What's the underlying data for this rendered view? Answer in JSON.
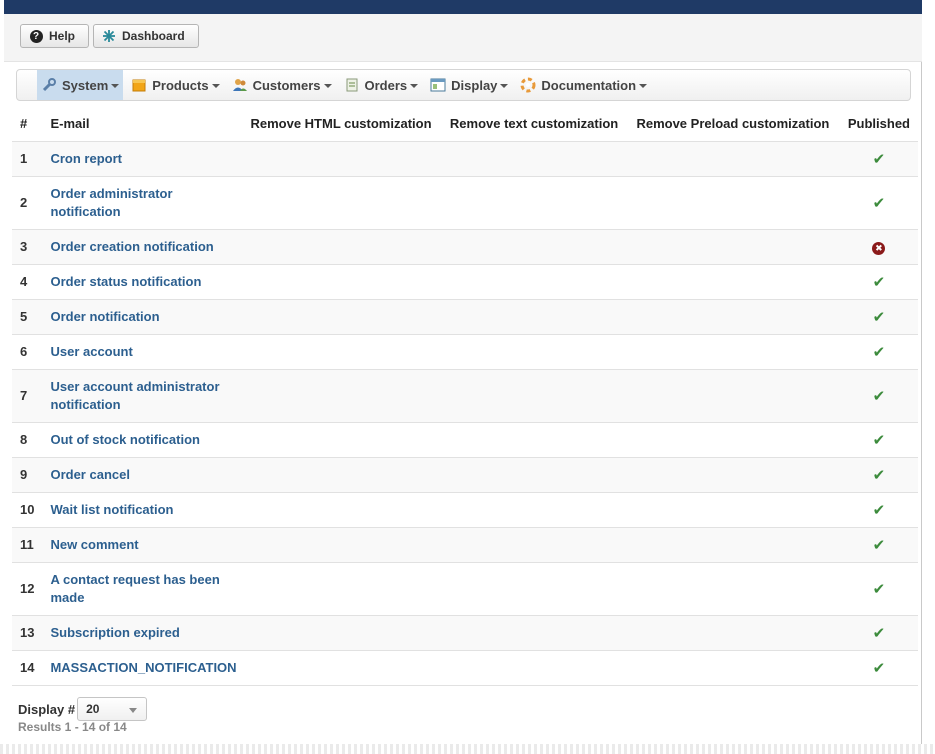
{
  "toolbar": {
    "help_label": "Help",
    "dashboard_label": "Dashboard"
  },
  "menu": [
    {
      "label": "System",
      "icon": "wrench-icon",
      "active": true
    },
    {
      "label": "Products",
      "icon": "box-icon"
    },
    {
      "label": "Customers",
      "icon": "users-icon"
    },
    {
      "label": "Orders",
      "icon": "orders-icon"
    },
    {
      "label": "Display",
      "icon": "display-icon"
    },
    {
      "label": "Documentation",
      "icon": "lifebuoy-icon"
    }
  ],
  "table": {
    "headers": [
      "#",
      "E-mail",
      "Remove HTML customization",
      "Remove text customization",
      "Remove Preload customization",
      "Published"
    ],
    "rows": [
      {
        "num": "1",
        "email": "Cron report",
        "published": true
      },
      {
        "num": "2",
        "email": "Order administrator notification",
        "published": true
      },
      {
        "num": "3",
        "email": "Order creation notification",
        "published": false
      },
      {
        "num": "4",
        "email": "Order status notification",
        "published": true
      },
      {
        "num": "5",
        "email": "Order notification",
        "published": true
      },
      {
        "num": "6",
        "email": "User account",
        "published": true
      },
      {
        "num": "7",
        "email": "User account administrator notification",
        "published": true
      },
      {
        "num": "8",
        "email": "Out of stock notification",
        "published": true
      },
      {
        "num": "9",
        "email": "Order cancel",
        "published": true
      },
      {
        "num": "10",
        "email": "Wait list notification",
        "published": true
      },
      {
        "num": "11",
        "email": "New comment",
        "published": true
      },
      {
        "num": "12",
        "email": "A contact request has been made",
        "published": true
      },
      {
        "num": "13",
        "email": "Subscription expired",
        "published": true
      },
      {
        "num": "14",
        "email": "MASSACTION_NOTIFICATION",
        "published": true
      }
    ]
  },
  "footer": {
    "display_label": "Display #",
    "display_value": "20",
    "results_text": "Results 1 - 14 of 14"
  },
  "colors": {
    "topbar": "#1f3a66",
    "link": "#2c5f8f",
    "published": "#3c8b3c",
    "unpublished": "#8b1a1a"
  }
}
